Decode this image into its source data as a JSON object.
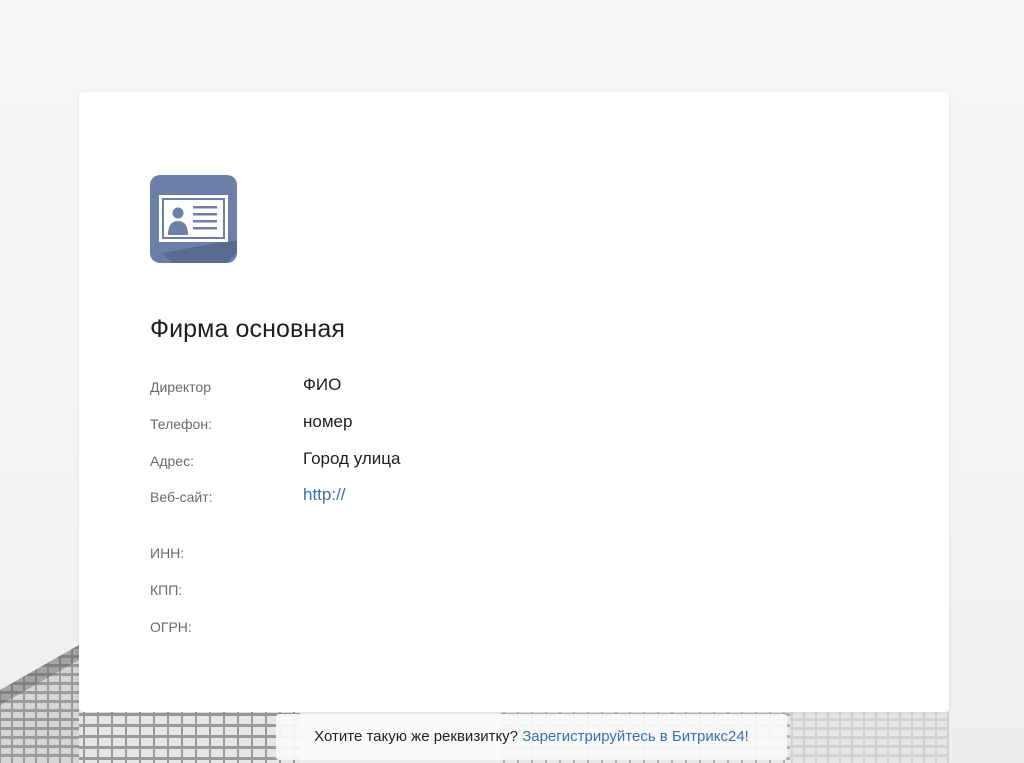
{
  "card": {
    "company_name": "Фирма основная",
    "logo_icon": "id-card-icon",
    "contact_fields": [
      {
        "label": "Директор",
        "value": "ФИО"
      },
      {
        "label": "Телефон:",
        "value": "номер"
      },
      {
        "label": "Адрес:",
        "value": "Город улица"
      },
      {
        "label": "Веб-сайт:",
        "value": "http://"
      }
    ],
    "requisites": [
      {
        "label": "ИНН:",
        "value": ""
      },
      {
        "label": "КПП:",
        "value": ""
      },
      {
        "label": "ОГРН:",
        "value": ""
      }
    ]
  },
  "footer": {
    "prompt": "Хотите такую же реквизитку?",
    "cta": "Зарегистрируйтесь в Битрикс24!"
  },
  "colors": {
    "logo_background": "#6c7fa8",
    "link": "#3a6fb0",
    "label": "#6a6a6a",
    "text": "#1e1e1e"
  }
}
